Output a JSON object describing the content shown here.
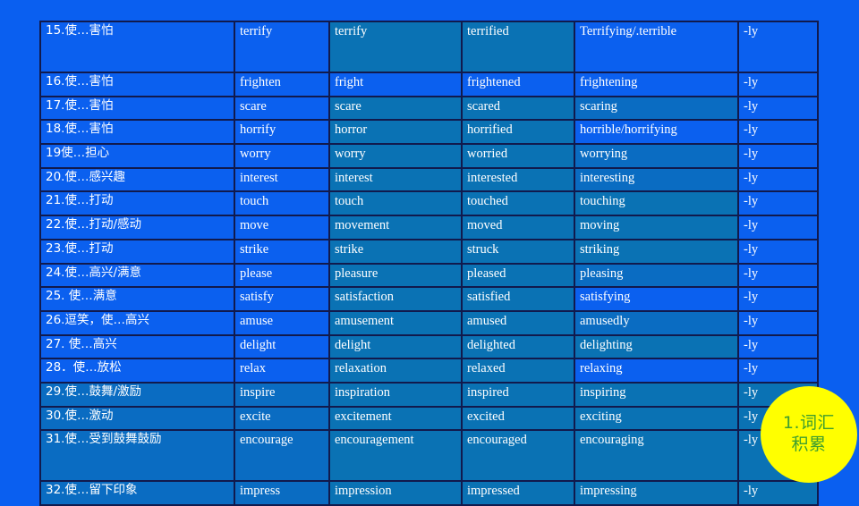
{
  "slide": {
    "background_color": "#0a5ff0",
    "table_border_color": "#111a4d",
    "cell_color": "#0b60ef",
    "cell_color_alt": "#0a72b4",
    "text_color": "#ffffff"
  },
  "badge": {
    "line1": "1.词汇",
    "line2": "积累",
    "fill_color": "#ffff00",
    "text_color": "#3f9e2e"
  },
  "table": {
    "columns": [
      "meaning",
      "verb",
      "noun",
      "past_participle_adj",
      "present_participle_adj",
      "adverb_suffix"
    ],
    "rows": [
      {
        "meaning": "15.使…害怕",
        "verb": "terrify",
        "noun": "terrify",
        "ed_form": "terrified",
        "ing_form": "Terrifying/.terrible",
        "adverb": "-ly"
      },
      {
        "meaning": "16.使…害怕",
        "verb": "frighten",
        "noun": "fright",
        "ed_form": "frightened",
        "ing_form": "frightening",
        "adverb": "-ly"
      },
      {
        "meaning": "17.使…害怕",
        "verb": "scare",
        "noun": "scare",
        "ed_form": "scared",
        "ing_form": "scaring",
        "adverb": "-ly"
      },
      {
        "meaning": "18.使…害怕",
        "verb": "horrify",
        "noun": "horror",
        "ed_form": "horrified",
        "ing_form": "horrible/horrifying",
        "adverb": "-ly"
      },
      {
        "meaning": "19使…担心",
        "verb": "worry",
        "noun": "worry",
        "ed_form": "worried",
        "ing_form": "worrying",
        "adverb": "-ly"
      },
      {
        "meaning": "20.使…感兴趣",
        "verb": "interest",
        "noun": "interest",
        "ed_form": "interested",
        "ing_form": "interesting",
        "adverb": "-ly"
      },
      {
        "meaning": "21.使…打动",
        "verb": "touch",
        "noun": "touch",
        "ed_form": "touched",
        "ing_form": "touching",
        "adverb": "-ly"
      },
      {
        "meaning": "22.使…打动/感动",
        "verb": "move",
        "noun": "movement",
        "ed_form": "moved",
        "ing_form": "moving",
        "adverb": "-ly"
      },
      {
        "meaning": "23.使…打动",
        "verb": "strike",
        "noun": "strike",
        "ed_form": "struck",
        "ing_form": "striking",
        "adverb": "-ly"
      },
      {
        "meaning": "24.使…高兴/满意",
        "verb": "please",
        "noun": "pleasure",
        "ed_form": "pleased",
        "ing_form": "pleasing",
        "adverb": "-ly"
      },
      {
        "meaning": "25. 使…满意",
        "verb": "satisfy",
        "noun": "satisfaction",
        "ed_form": "satisfied",
        "ing_form": "satisfying",
        "adverb": "-ly"
      },
      {
        "meaning": "26.逗笑，使…高兴",
        "verb": "amuse",
        "noun": "amusement",
        "ed_form": "amused",
        "ing_form": "amusedly",
        "adverb": "-ly"
      },
      {
        "meaning": "27. 使…高兴",
        "verb": "delight",
        "noun": "delight",
        "ed_form": "delighted",
        "ing_form": "delighting",
        "adverb": "-ly"
      },
      {
        "meaning": "28．使…放松",
        "verb": "relax",
        "noun": "relaxation",
        "ed_form": "relaxed",
        "ing_form": "relaxing",
        "adverb": "-ly"
      },
      {
        "meaning": "29.使…鼓舞/激励",
        "verb": "inspire",
        "noun": "inspiration",
        "ed_form": "inspired",
        "ing_form": "inspiring",
        "adverb": "-ly"
      },
      {
        "meaning": "30.使…激动",
        "verb": "excite",
        "noun": "excitement",
        "ed_form": "excited",
        "ing_form": "exciting",
        "adverb": "-ly"
      },
      {
        "meaning": "31.使…受到鼓舞鼓励",
        "verb": "encourage",
        "noun": "encouragement",
        "ed_form": "encouraged",
        "ing_form": "encouraging",
        "adverb": "-ly"
      },
      {
        "meaning": "32.使…留下印象",
        "verb": "impress",
        "noun": "impression",
        "ed_form": "impressed",
        "ing_form": "impressing",
        "adverb": "-ly"
      }
    ]
  }
}
